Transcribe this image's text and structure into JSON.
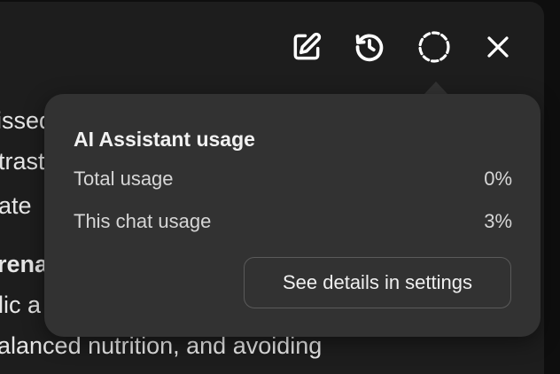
{
  "toolbar": {
    "icons": [
      "edit-icon",
      "history-icon",
      "usage-ring-icon",
      "close-icon"
    ]
  },
  "background_text": {
    "line1": "issed",
    "line2": "trast",
    "line3": "ate",
    "line4": "renal",
    "line5": "lic a",
    "line6": "alanced nutrition, and avoiding"
  },
  "usage_popover": {
    "title": "AI Assistant usage",
    "rows": [
      {
        "label": "Total usage",
        "value": "0%"
      },
      {
        "label": "This chat usage",
        "value": "3%"
      }
    ],
    "details_button_label": "See details in settings"
  },
  "colors": {
    "panel_bg": "#1d1d1d",
    "popover_bg": "#323232",
    "icon": "#ffffff"
  }
}
